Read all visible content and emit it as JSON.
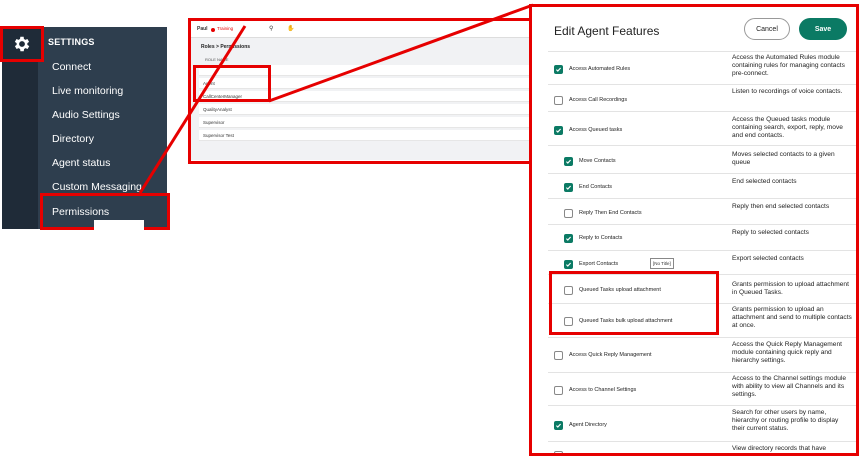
{
  "sidebar": {
    "title": "SETTINGS",
    "items": [
      {
        "label": "Connect"
      },
      {
        "label": "Live monitoring"
      },
      {
        "label": "Audio Settings"
      },
      {
        "label": "Directory"
      },
      {
        "label": "Agent status"
      },
      {
        "label": "Custom Messaging"
      },
      {
        "label": "Permissions"
      }
    ]
  },
  "mini": {
    "user": "Paul",
    "status": "Training",
    "header": "Roles > Permissions",
    "column": "ROLE NAME",
    "roles": [
      "Agent",
      "CallCenterManager",
      "QualityAnalyst",
      "Supervisor",
      "Supervisor Test"
    ]
  },
  "panel": {
    "title": "Edit Agent Features",
    "cancel_label": "Cancel",
    "save_label": "Save",
    "tooltip": "[No Title]",
    "features": [
      {
        "name": "Access Automated Rules",
        "checked": true,
        "desc": "Access the Automated Rules module containing rules for managing contacts pre-connect."
      },
      {
        "name": "Access Call Recordings",
        "checked": false,
        "desc": "Listen to recordings of voice contacts."
      },
      {
        "name": "Access Queued tasks",
        "checked": true,
        "desc": "Access the Queued tasks module containing search, export, reply, move and end contacts."
      },
      {
        "name": "Move Contacts",
        "checked": true,
        "desc": "Moves selected contacts to a given queue"
      },
      {
        "name": "End Contacts",
        "checked": true,
        "desc": "End selected contacts"
      },
      {
        "name": "Reply Then End Contacts",
        "checked": false,
        "desc": "Reply then end selected contacts"
      },
      {
        "name": "Reply to Contacts",
        "checked": true,
        "desc": "Reply to selected contacts"
      },
      {
        "name": "Export Contacts",
        "checked": true,
        "desc": "Export selected contacts"
      },
      {
        "name": "Queued Tasks upload attachment",
        "checked": false,
        "desc": "Grants permission to upload attachment in Queued Tasks."
      },
      {
        "name": "Queued Tasks bulk upload attachment",
        "checked": false,
        "desc": "Grants permission to upload an attachment and send to multiple contacts at once."
      },
      {
        "name": "Access Quick Reply Management",
        "checked": false,
        "desc": "Access the Quick Reply Management module containing quick reply and hierarchy settings."
      },
      {
        "name": "Access to Channel Settings",
        "checked": false,
        "desc": "Access to the Channel settings module with ability to view all Channels and its settings."
      },
      {
        "name": "Agent Directory",
        "checked": true,
        "desc": "Search for other users by name, hierarchy or routing profile to display their current status."
      },
      {
        "name": "",
        "checked": false,
        "desc": "View directory records that have"
      }
    ]
  },
  "colors": {
    "accent": "#0b7a64",
    "highlight": "#e60000",
    "sidebar": "#2e3e4e"
  }
}
